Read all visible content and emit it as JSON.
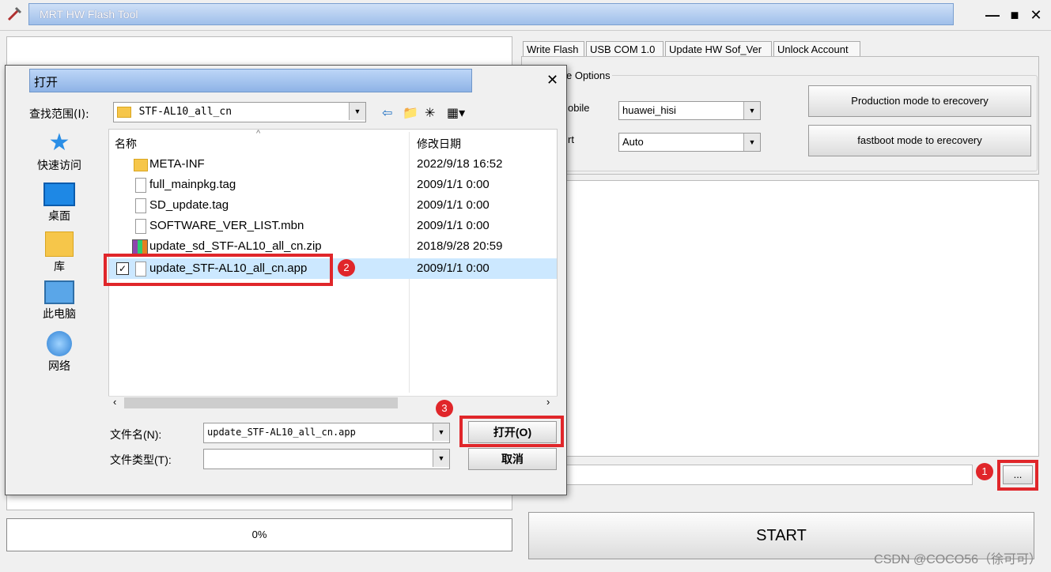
{
  "window": {
    "title": "MRT HW Flash Tool",
    "minimize": "—",
    "maximize": "■",
    "close": "✕"
  },
  "tabs": [
    {
      "label": "Write Flash"
    },
    {
      "label": "USB COM 1.0"
    },
    {
      "label": "Update HW Sof_Ver"
    },
    {
      "label": "Unlock Account"
    }
  ],
  "options": {
    "group_label": "e Options",
    "mobile_label": "obile",
    "mobile_value": "huawei_hisi",
    "port_label": "rt",
    "port_value": "Auto",
    "production_button": "Production mode to erecovery",
    "fastboot_button": "fastboot mode to erecovery"
  },
  "browse_button": "...",
  "progress": "0%",
  "start_button": "START",
  "watermark": "CSDN @COCO56（徐可可）",
  "badges": {
    "one": "1",
    "two": "2",
    "three": "3"
  },
  "dialog": {
    "title": "打开",
    "close": "✕",
    "lookin_label": "查找范围(I):",
    "lookin_value": "STF-AL10_all_cn",
    "places": [
      {
        "label": "快速访问"
      },
      {
        "label": "桌面"
      },
      {
        "label": "库"
      },
      {
        "label": "此电脑"
      },
      {
        "label": "网络"
      }
    ],
    "columns": {
      "name": "名称",
      "modified": "修改日期"
    },
    "files": [
      {
        "name": "META-INF",
        "date": "2022/9/18 16:52"
      },
      {
        "name": "full_mainpkg.tag",
        "date": "2009/1/1 0:00"
      },
      {
        "name": "SD_update.tag",
        "date": "2009/1/1 0:00"
      },
      {
        "name": "SOFTWARE_VER_LIST.mbn",
        "date": "2009/1/1 0:00"
      },
      {
        "name": "update_sd_STF-AL10_all_cn.zip",
        "date": "2018/9/28 20:59"
      },
      {
        "name": "update_STF-AL10_all_cn.app",
        "date": "2009/1/1 0:00"
      }
    ],
    "filename_label": "文件名(N):",
    "filename_value": "update_STF-AL10_all_cn.app",
    "filetype_label": "文件类型(T):",
    "filetype_value": "",
    "open_button": "打开(O)",
    "cancel_button": "取消"
  }
}
